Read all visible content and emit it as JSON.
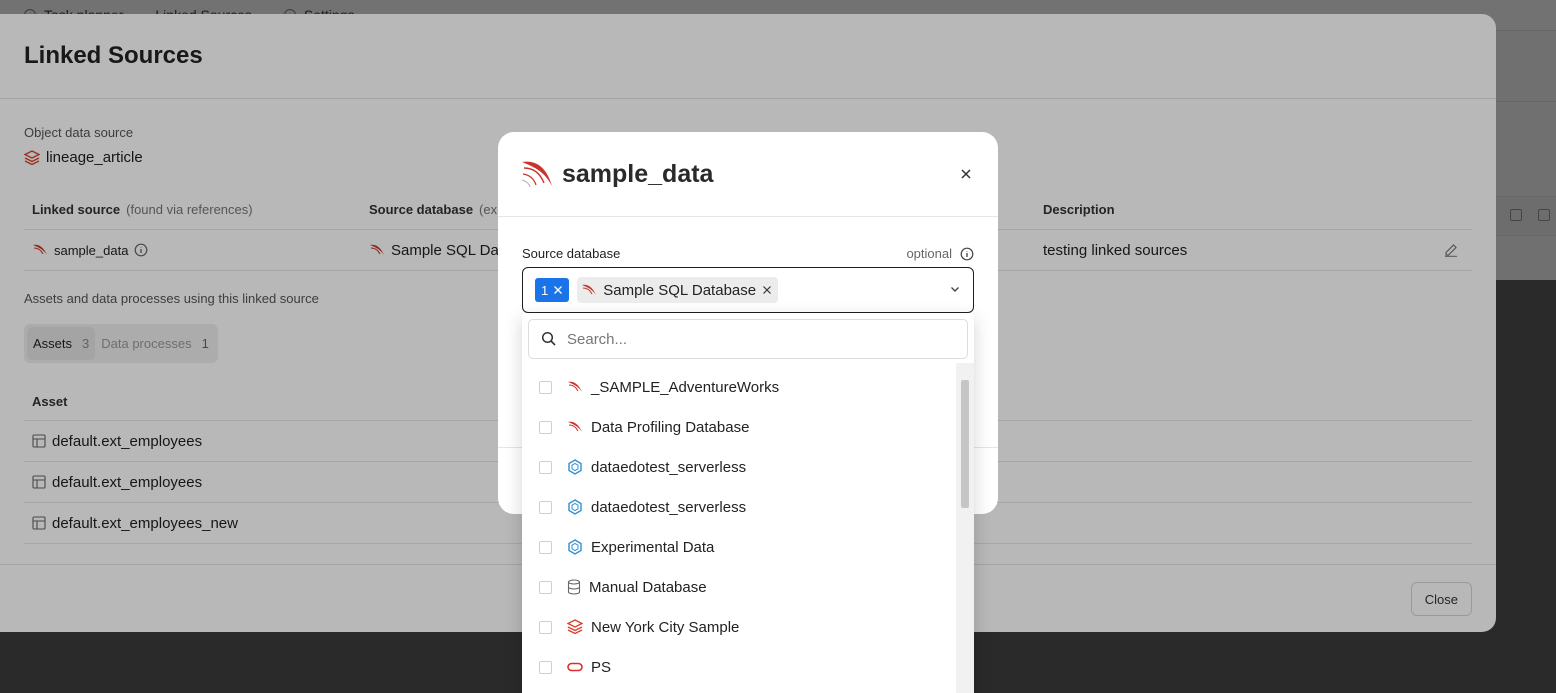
{
  "app_tabs": [
    "Task planner",
    "Linked Sources",
    "Settings"
  ],
  "linked_sources_dialog": {
    "title": "Linked Sources",
    "object_data_source_label": "Object data source",
    "object_data_source_value": "lineage_article",
    "columns": {
      "linked_source": "Linked source",
      "linked_source_note": "(found via references)",
      "source_database": "Source database",
      "source_database_note": "(exis",
      "description": "Description"
    },
    "row": {
      "linked_source": "sample_data",
      "source_database": "Sample SQL Data",
      "description": "testing linked sources"
    },
    "assets_section_label": "Assets and data processes using this linked source",
    "tabs": [
      {
        "label": "Assets",
        "count": "3"
      },
      {
        "label": "Data processes",
        "count": "1"
      }
    ],
    "asset_column": "Asset",
    "assets": [
      "default.ext_employees",
      "default.ext_employees",
      "default.ext_employees_new"
    ],
    "close_label": "Close"
  },
  "modal": {
    "title": "sample_data",
    "source_database_label": "Source database",
    "optional_label": "optional",
    "selected_count": "1",
    "selected_value": "Sample SQL Database"
  },
  "dropdown": {
    "search_placeholder": "Search...",
    "options": [
      {
        "label": "_SAMPLE_AdventureWorks",
        "icon": "sql-server-icon"
      },
      {
        "label": "Data Profiling Database",
        "icon": "sql-server-icon"
      },
      {
        "label": "dataedotest_serverless",
        "icon": "hexagon-icon"
      },
      {
        "label": "dataedotest_serverless",
        "icon": "hexagon-icon"
      },
      {
        "label": "Experimental Data",
        "icon": "hexagon-icon"
      },
      {
        "label": "Manual Database",
        "icon": "database-icon"
      },
      {
        "label": "New York City Sample",
        "icon": "databricks-icon"
      },
      {
        "label": "PS",
        "icon": "oracle-icon"
      }
    ]
  },
  "colors": {
    "accent_blue": "#1a73e8",
    "sql_red": "#c8342c",
    "hex_blue": "#2f8fd0",
    "oracle_red": "#d9302a"
  }
}
